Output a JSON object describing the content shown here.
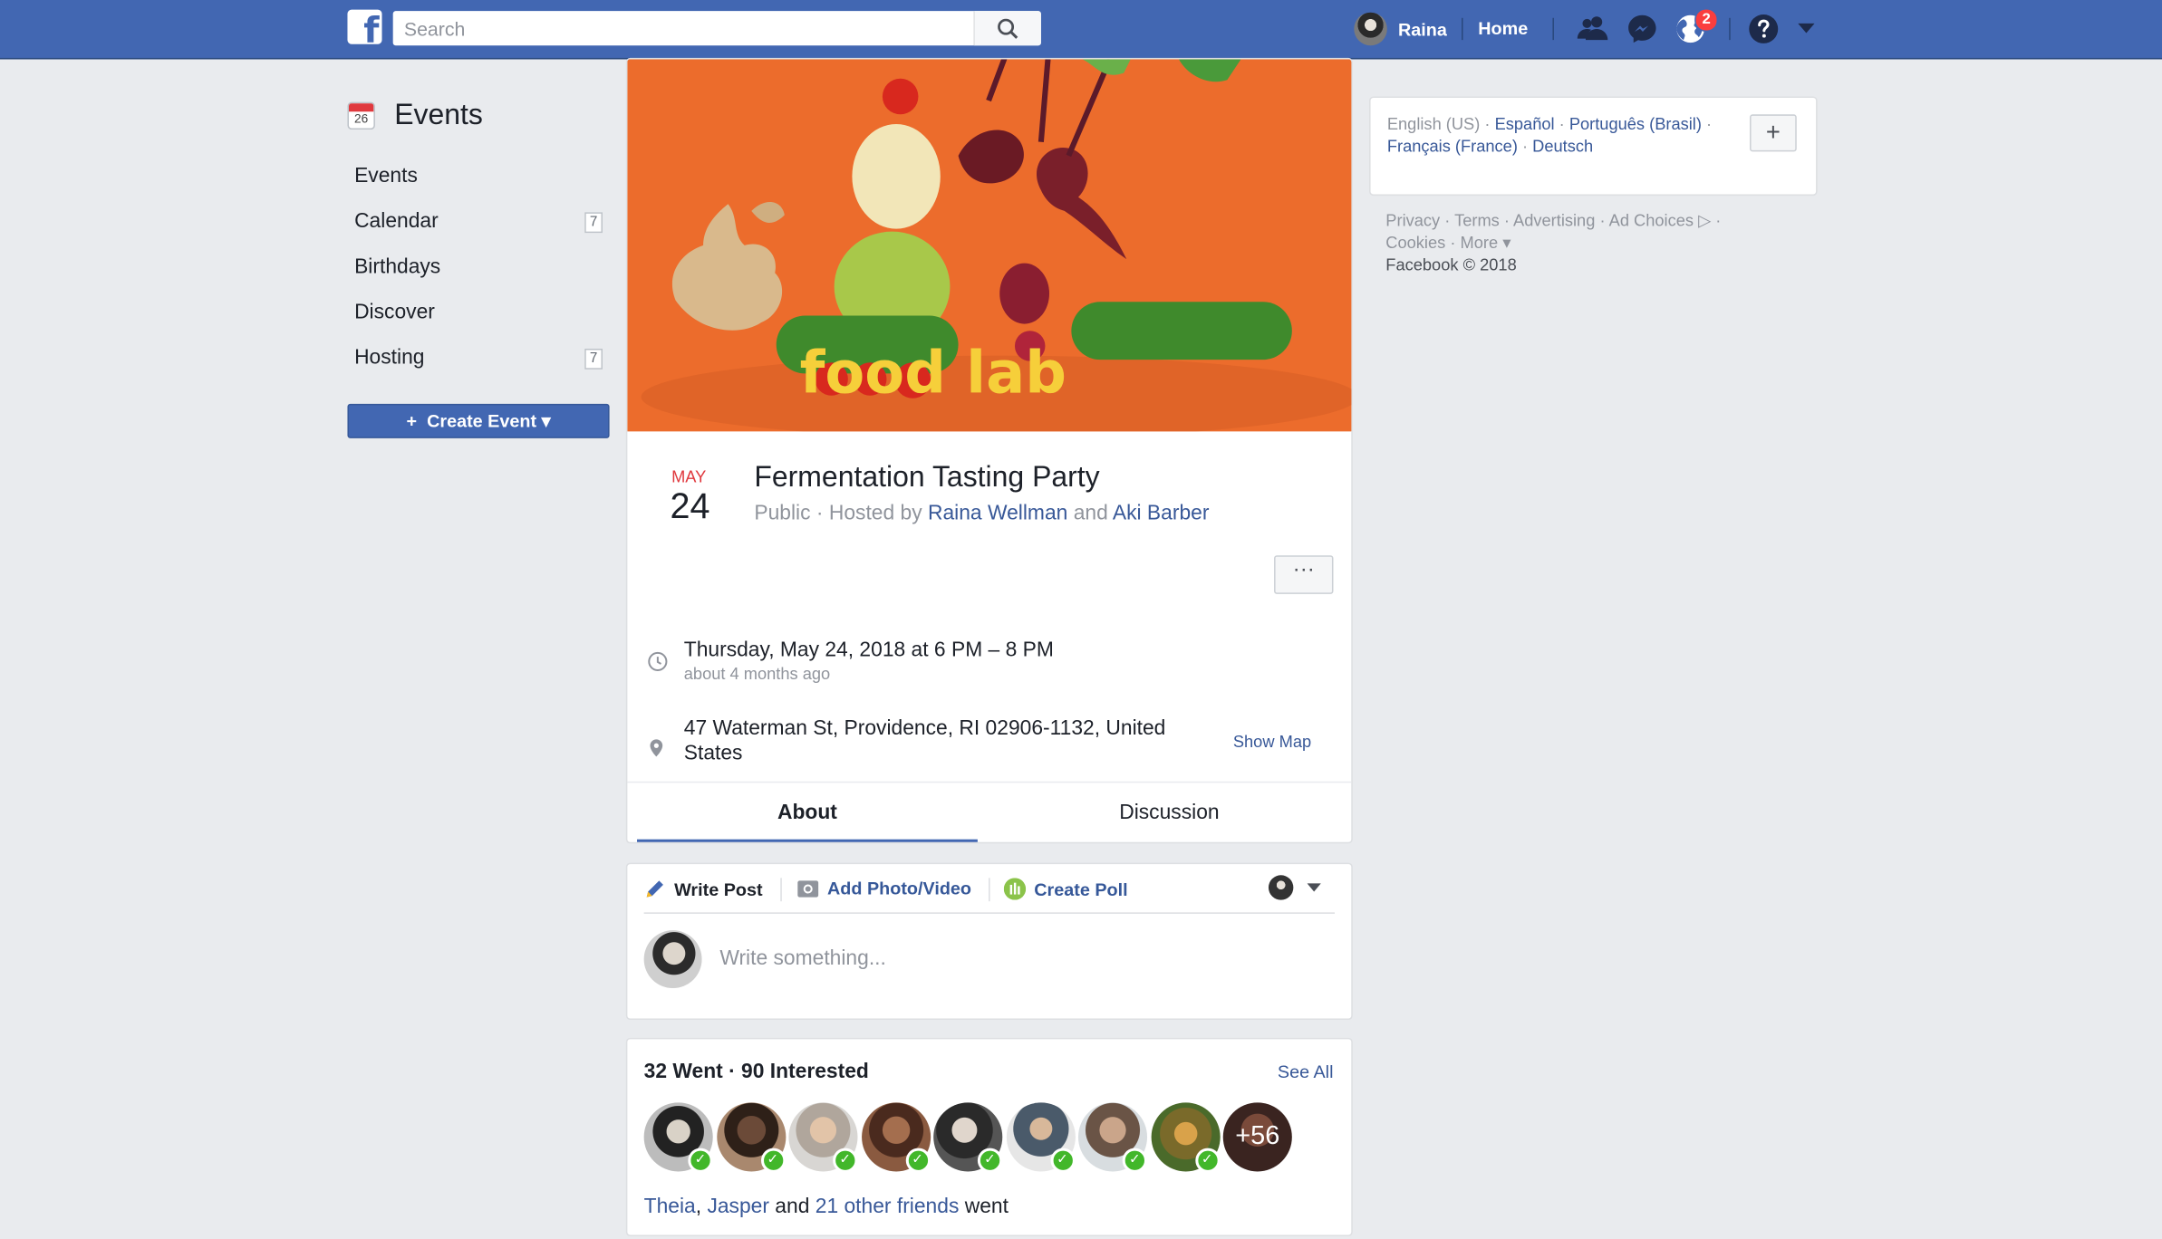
{
  "topbar": {
    "search_placeholder": "Search",
    "user_name": "Raina",
    "home_label": "Home",
    "notifications_count": "2",
    "icons": [
      "facebook-logo-icon",
      "search-icon",
      "friends-icon",
      "messenger-icon",
      "globe-icon",
      "help-icon",
      "caret-down-icon"
    ],
    "brand_color": "#4267b2"
  },
  "sidebar": {
    "title": "Events",
    "calendar_icon_day": "26",
    "items": [
      {
        "label": "Events"
      },
      {
        "label": "Calendar",
        "count": "7"
      },
      {
        "label": "Birthdays"
      },
      {
        "label": "Discover"
      },
      {
        "label": "Hosting",
        "count": "7"
      }
    ],
    "create_button": "Create Event"
  },
  "event": {
    "cover_text": "food lab",
    "month": "MAY",
    "day": "24",
    "title": "Fermentation Tasting Party",
    "privacy": "Public",
    "hosted_by": "Hosted by",
    "host1": "Raina Wellman",
    "and": "and",
    "host2": "Aki Barber",
    "more_label": "···",
    "datetime": "Thursday, May 24, 2018 at 6 PM – 8 PM",
    "relative_time": "about 4 months ago",
    "address": "47 Waterman St, Providence, RI 02906-1132, United States",
    "show_map": "Show Map",
    "tabs": [
      {
        "label": "About",
        "active": true
      },
      {
        "label": "Discussion",
        "active": false
      }
    ]
  },
  "composer": {
    "write_post": "Write Post",
    "add_photo": "Add Photo/Video",
    "create_poll": "Create Poll",
    "placeholder": "Write something..."
  },
  "guests": {
    "summary": "32 Went · 90 Interested",
    "see_all": "See All",
    "more_count": "+56",
    "friend1": "Theia",
    "friend2": "Jasper",
    "others": "21 other friends",
    "went": "went"
  },
  "right": {
    "languages": {
      "current": "English (US)",
      "others": [
        "Español",
        "Português (Brasil)",
        "Français (France)",
        "Deutsch"
      ],
      "add_label": "+"
    },
    "footer_links": [
      "Privacy",
      "Terms",
      "Advertising",
      "Ad Choices",
      "Cookies",
      "More"
    ],
    "copyright": "Facebook © 2018"
  }
}
